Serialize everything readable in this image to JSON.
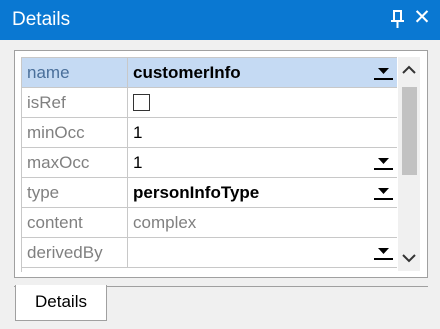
{
  "panel": {
    "title": "Details",
    "pin_icon": "pin-icon",
    "close_symbol": "✕"
  },
  "properties": [
    {
      "name": "name",
      "value": "customerInfo",
      "control": "dropdown",
      "selected": true
    },
    {
      "name": "isRef",
      "value": "",
      "control": "checkbox",
      "checked": false
    },
    {
      "name": "minOcc",
      "value": "1",
      "control": "text"
    },
    {
      "name": "maxOcc",
      "value": "1",
      "control": "dropdown"
    },
    {
      "name": "type",
      "value": "personInfoType",
      "control": "dropdown"
    },
    {
      "name": "content",
      "value": "complex",
      "control": "readonly"
    },
    {
      "name": "derivedBy",
      "value": "",
      "control": "dropdown"
    }
  ],
  "tabs": [
    {
      "label": "Details",
      "active": true
    }
  ],
  "colors": {
    "titlebar": "#0a78d2",
    "selection": "#c5daf3",
    "label_text": "#808080"
  }
}
